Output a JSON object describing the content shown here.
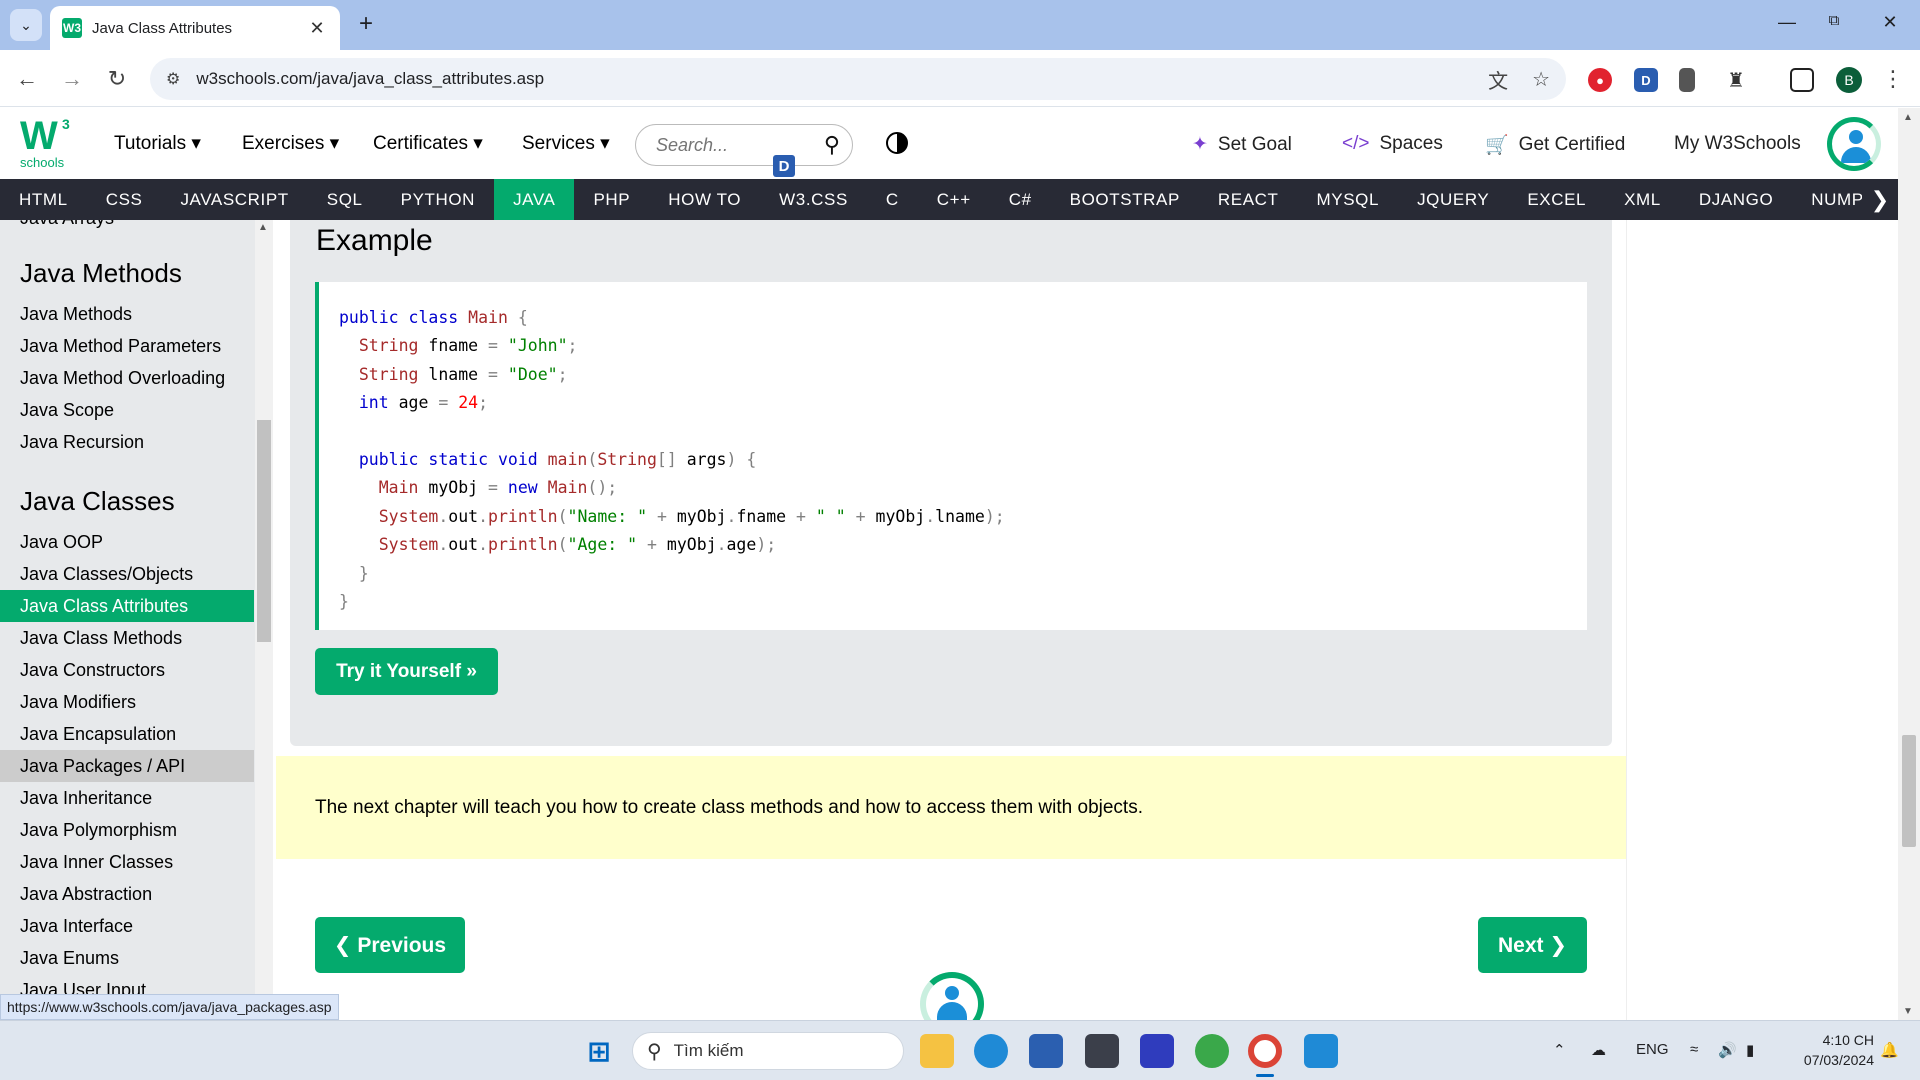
{
  "browser": {
    "tab_title": "Java Class Attributes",
    "favicon_text": "W3",
    "url": "w3schools.com/java/java_class_attributes.asp",
    "profile_initial": "B",
    "status_url": "https://www.w3schools.com/java/java_packages.asp",
    "icons": [
      "tab-search-icon",
      "close-icon",
      "plus-icon",
      "minimize-icon",
      "restore-icon",
      "close-window-icon",
      "back-icon",
      "forward-icon",
      "reload-icon",
      "site-info-icon",
      "translate-icon",
      "star-icon",
      "extensions-icon",
      "sidebar-icon",
      "menu-icon"
    ]
  },
  "header": {
    "logo_letter": "W",
    "logo_superscript": "3",
    "logo_sub": "schools",
    "menu": [
      "Tutorials ▾",
      "Exercises ▾",
      "Certificates ▾",
      "Services ▾"
    ],
    "search_placeholder": "Search...",
    "badge_letter": "D",
    "set_goal": "Set Goal",
    "spaces": "Spaces",
    "get_certified": "Get Certified",
    "my_w3schools": "My W3Schools"
  },
  "topnav": {
    "items": [
      "HTML",
      "CSS",
      "JAVASCRIPT",
      "SQL",
      "PYTHON",
      "JAVA",
      "PHP",
      "HOW TO",
      "W3.CSS",
      "C",
      "C++",
      "C#",
      "BOOTSTRAP",
      "REACT",
      "MYSQL",
      "JQUERY",
      "EXCEL",
      "XML",
      "DJANGO",
      "NUMPY"
    ],
    "active": "JAVA"
  },
  "sidebar": {
    "cut_item": "Java Arrays",
    "sections": [
      {
        "heading": "Java Methods",
        "items": [
          "Java Methods",
          "Java Method Parameters",
          "Java Method Overloading",
          "Java Scope",
          "Java Recursion"
        ]
      },
      {
        "heading": "Java Classes",
        "items": [
          "Java OOP",
          "Java Classes/Objects",
          "Java Class Attributes",
          "Java Class Methods",
          "Java Constructors",
          "Java Modifiers",
          "Java Encapsulation",
          "Java Packages / API",
          "Java Inheritance",
          "Java Polymorphism",
          "Java Inner Classes",
          "Java Abstraction",
          "Java Interface",
          "Java Enums",
          "Java User Input"
        ]
      }
    ],
    "active_item": "Java Class Attributes",
    "hover_item": "Java Packages / API"
  },
  "main": {
    "example_title": "Example",
    "try_button": "Try it Yourself »",
    "note": "The next chapter will teach you how to create class methods and how to access them with objects.",
    "prev_button": "❮ Previous",
    "next_button": "Next ❯"
  },
  "taskbar": {
    "search_placeholder": "Tìm kiếm",
    "language": "ENG",
    "time": "4:10 CH",
    "date": "07/03/2024"
  }
}
